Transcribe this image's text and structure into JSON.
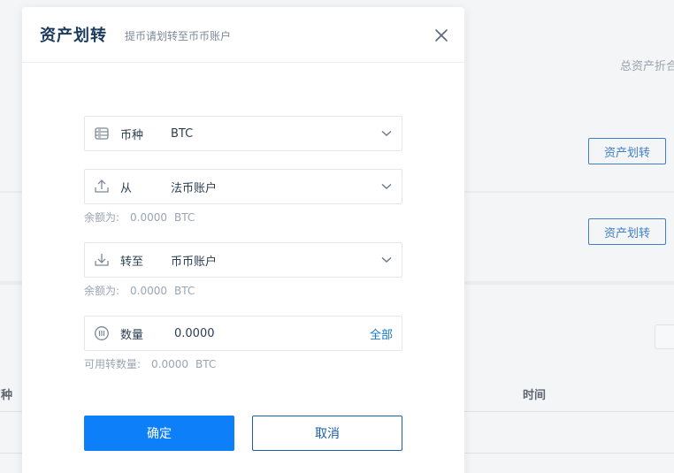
{
  "background": {
    "total_assets_label": "总资产折合",
    "transfer_button_1": "资产划转",
    "transfer_button_2": "资产划转",
    "table_col_currency": "币种",
    "table_col_time": "时间"
  },
  "modal": {
    "title": "资产划转",
    "subtitle": "提币请划转至币币账户",
    "fields": {
      "currency": {
        "label": "币种",
        "value": "BTC",
        "icon": "coin-stack-icon"
      },
      "from": {
        "label": "从",
        "value": "法币账户",
        "icon": "upload-icon"
      },
      "to": {
        "label": "转至",
        "value": "币币账户",
        "icon": "download-icon"
      },
      "amount": {
        "label": "数量",
        "value": "0.0000",
        "icon": "amount-icon",
        "all_label": "全部"
      }
    },
    "from_balance": {
      "label": "余额为:",
      "amount": "0.0000",
      "unit": "BTC"
    },
    "to_balance": {
      "label": "余额为:",
      "amount": "0.0000",
      "unit": "BTC"
    },
    "available": {
      "label": "可用转数量:",
      "amount": "0.0000",
      "unit": "BTC"
    },
    "confirm_label": "确定",
    "cancel_label": "取消"
  },
  "colors": {
    "primary": "#0d7ff8",
    "title": "#1b3a5c",
    "link": "#1677cc"
  }
}
